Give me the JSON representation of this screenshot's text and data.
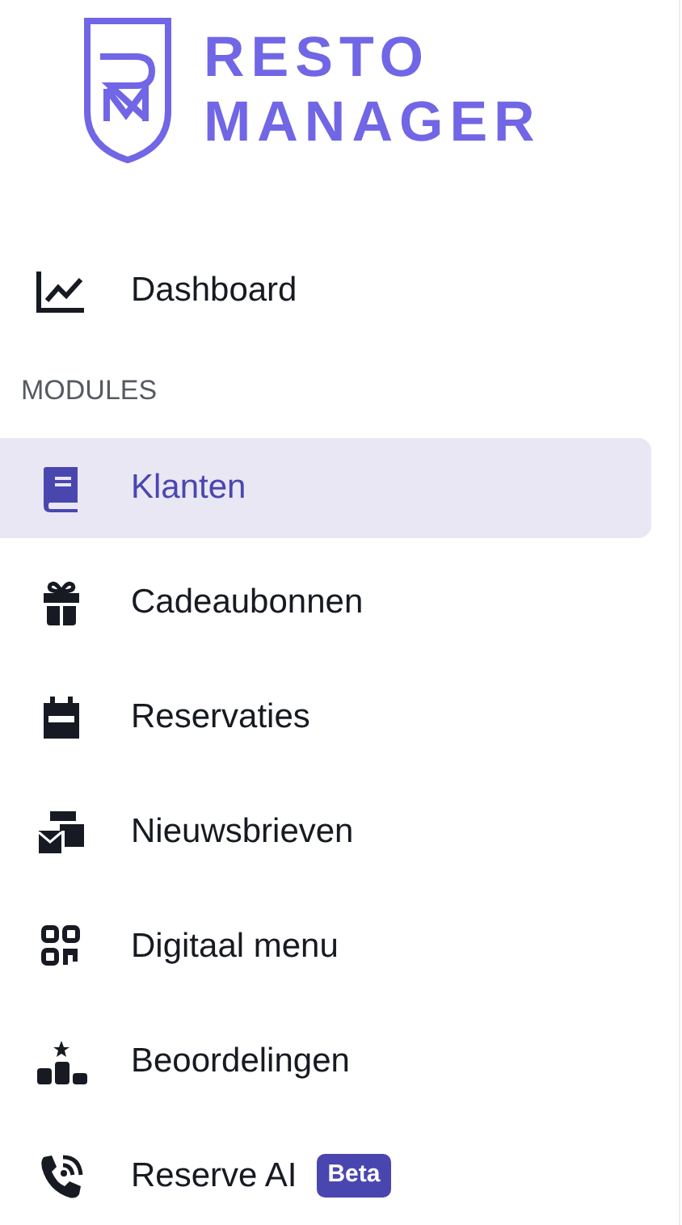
{
  "logo": {
    "line_1": "RESTO",
    "line_2": "MANAGER"
  },
  "top_items": [
    {
      "label": "Dashboard",
      "selected": false
    }
  ],
  "section": "MODULES",
  "items": [
    {
      "label": "Klanten",
      "selected": true
    },
    {
      "label": "Cadeaubonnen",
      "selected": false
    },
    {
      "label": "Reservaties",
      "selected": false
    },
    {
      "label": "Nieuwsbrieven",
      "selected": false
    },
    {
      "label": "Digitaal menu",
      "selected": false
    },
    {
      "label": "Beoordelingen",
      "selected": false
    },
    {
      "label": "Reserve AI",
      "selected": false,
      "badge": "Beta"
    }
  ]
}
